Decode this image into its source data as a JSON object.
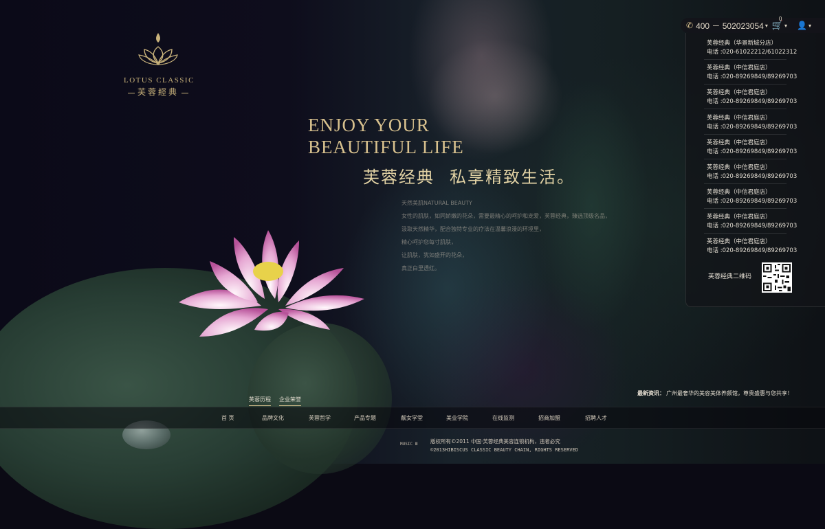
{
  "colors": {
    "gold": "#d8c18e",
    "panel_bg": "#121418",
    "text_light": "#e3ddd2"
  },
  "logo": {
    "en": "LOTUS CLASSIC",
    "cn": "芙蓉經典",
    "icon": "lotus-logo-icon"
  },
  "headline": {
    "line1": "ENJOY YOUR",
    "line2": "BEAUTIFUL LIFE",
    "cn_part1": "芙蓉经典",
    "cn_part2": "私享精致生活。"
  },
  "intro": [
    "天然美肌NATURAL BEAUTY",
    "女性的肌肤，如同娇嫩的花朵，需要最精心的呵护和宠爱，芙蓉经典，臻选顶级名品，",
    "汲取天然精华，配合独特专业的疗法在温馨浪漫的环境里，",
    "精心呵护您每寸肌肤，",
    "让肌肤，犹如盛开的花朵，",
    "真正白里透红。"
  ],
  "topbar": {
    "phone": "400 － 502023054",
    "cart_count": "0",
    "phone_icon": "phone-icon",
    "cart_icon": "cart-icon",
    "user_icon": "user-icon"
  },
  "stores": [
    {
      "name": "芙蓉经典（华景新城分店）",
      "phone": "电话 :020-61022212/61022312"
    },
    {
      "name": "芙蓉经典（中信君庭店）",
      "phone": "电话 :020-89269849/89269703"
    },
    {
      "name": "芙蓉经典（中信君庭店）",
      "phone": "电话 :020-89269849/89269703"
    },
    {
      "name": "芙蓉经典（中信君庭店）",
      "phone": "电话 :020-89269849/89269703"
    },
    {
      "name": "芙蓉经典（中信君庭店）",
      "phone": "电话 :020-89269849/89269703"
    },
    {
      "name": "芙蓉经典（中信君庭店）",
      "phone": "电话 :020-89269849/89269703"
    },
    {
      "name": "芙蓉经典（中信君庭店）",
      "phone": "电话 :020-89269849/89269703"
    },
    {
      "name": "芙蓉经典（中信君庭店）",
      "phone": "电话 :020-89269849/89269703"
    },
    {
      "name": "芙蓉经典（中信君庭店）",
      "phone": "电话 :020-89269849/89269703"
    }
  ],
  "qr": {
    "label": "芙蓉经典二维码"
  },
  "news": {
    "label": "最新资讯：",
    "text": "广州最奢华的美容美体养颜馆，尊贵盛惠与您共享！"
  },
  "mini_tabs": [
    "芙蓉历程",
    "企业荣誉"
  ],
  "nav": [
    "首 页",
    "品牌文化",
    "芙蓉哲学",
    "产品专题",
    "靓女学堂",
    "美业学院",
    "在线监测",
    "招商加盟",
    "招聘人才"
  ],
  "footer": {
    "music": "MUSIC Ⅲ",
    "cn": "版权所有©2011 中国·芙蓉经典美容连锁机构，违者必究",
    "en": "©2013HIBISCUS CLASSIC BEAUTY CHAIN, RIGHTS RESERVED"
  }
}
